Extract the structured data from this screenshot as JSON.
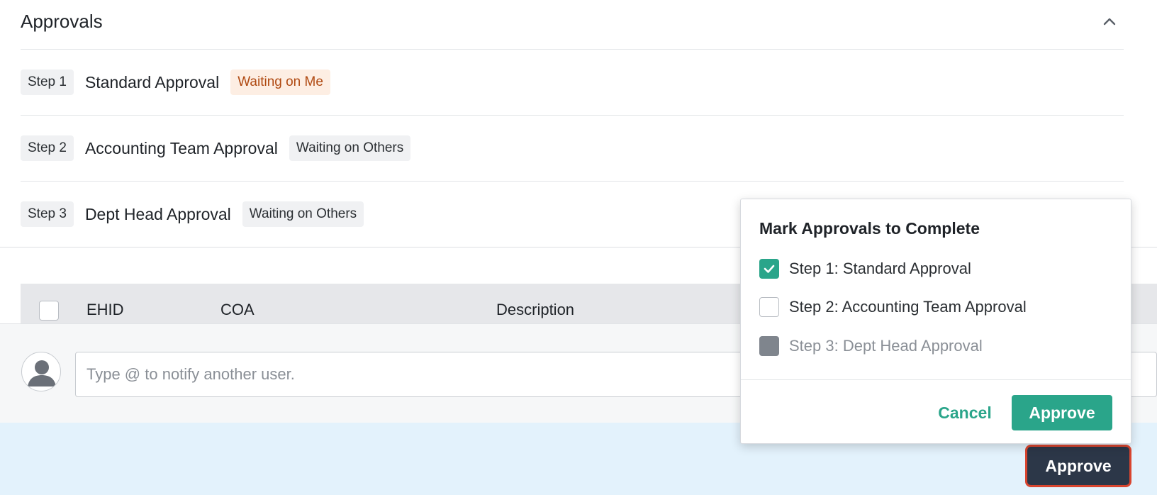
{
  "approvals": {
    "title": "Approvals",
    "steps": [
      {
        "tag": "Step 1",
        "name": "Standard Approval",
        "status": "Waiting on Me"
      },
      {
        "tag": "Step 2",
        "name": "Accounting Team Approval",
        "status": "Waiting on Others"
      },
      {
        "tag": "Step 3",
        "name": "Dept Head Approval",
        "status": "Waiting on Others"
      }
    ]
  },
  "table": {
    "columns": [
      "EHID",
      "COA",
      "Description"
    ]
  },
  "comment": {
    "placeholder": "Type @ to notify another user."
  },
  "popover": {
    "title": "Mark Approvals to Complete",
    "options": [
      {
        "label": "Step 1: Standard Approval",
        "state": "checked"
      },
      {
        "label": "Step 2: Accounting Team Approval",
        "state": "unchecked"
      },
      {
        "label": "Step 3: Dept Head Approval",
        "state": "disabled"
      }
    ],
    "cancel_label": "Cancel",
    "approve_label": "Approve"
  },
  "footer": {
    "approve_label": "Approve"
  },
  "colors": {
    "accent_green": "#2aa58a",
    "primary_dark": "#2c3748",
    "badge_me_bg": "#fdeee3",
    "badge_me_text": "#b04a12",
    "footer_bg": "#e3f2fc"
  },
  "icons": {
    "collapse": "chevron-up-icon",
    "avatar": "user-avatar-icon",
    "check": "checkmark-icon"
  }
}
